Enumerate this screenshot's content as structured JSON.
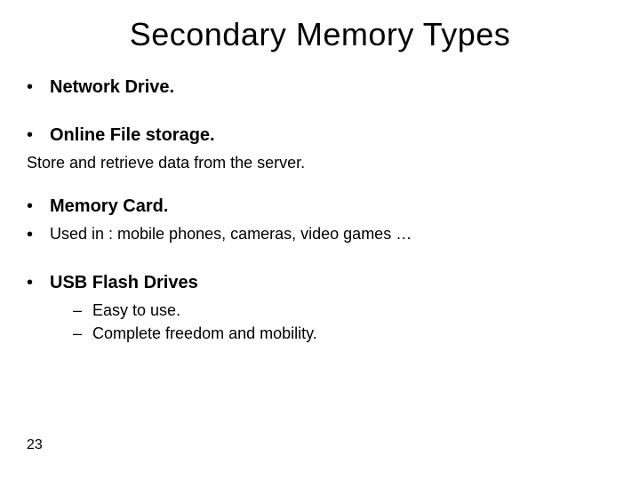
{
  "title": "Secondary Memory Types",
  "items": {
    "network_drive": "Network Drive.",
    "online_file_storage": "Online File storage.",
    "online_file_storage_desc": "Store and retrieve data from the server.",
    "memory_card": "Memory Card.",
    "memory_card_desc": "Used in : mobile phones, cameras, video games …",
    "usb_flash": "USB Flash Drives",
    "usb_sub": {
      "a": "Easy to use.",
      "b": "Complete freedom and mobility."
    }
  },
  "page_number": "23"
}
